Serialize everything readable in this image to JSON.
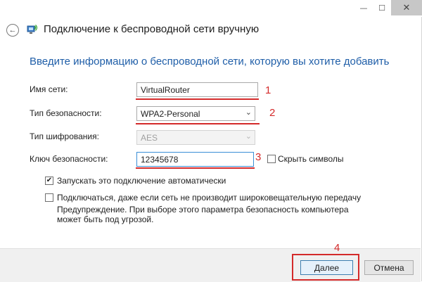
{
  "window": {
    "controls": {
      "minimize": "—",
      "maximize": "☐",
      "close": "✕"
    }
  },
  "header": {
    "back": "←",
    "title": "Подключение к беспроводной сети вручную"
  },
  "main": {
    "heading": "Введите информацию о беспроводной сети, которую вы хотите добавить"
  },
  "form": {
    "network_name": {
      "label": "Имя сети:",
      "value": "VirtualRouter"
    },
    "security_type": {
      "label": "Тип безопасности:",
      "value": "WPA2-Personal"
    },
    "encryption_type": {
      "label": "Тип шифрования:",
      "value": "AES"
    },
    "security_key": {
      "label": "Ключ безопасности:",
      "value": "12345678"
    },
    "hide_characters": {
      "label": "Скрыть символы",
      "checked": false
    }
  },
  "options": {
    "auto_connect": {
      "label": "Запускать это подключение автоматически",
      "checked": true
    },
    "connect_hidden": {
      "label": "Подключаться, даже если сеть не производит широковещательную передачу",
      "checked": false
    },
    "warning": "Предупреждение. При выборе этого параметра безопасность компьютера может быть под угрозой."
  },
  "annotations": {
    "m1": "1",
    "m2": "2",
    "m3": "3",
    "m4": "4"
  },
  "buttons": {
    "next": "Далее",
    "cancel": "Отмена"
  },
  "colors": {
    "accent": "#1f5ea8",
    "annotation_red": "#d42a2a"
  },
  "icons": {
    "back": "back-arrow-icon",
    "network": "wireless-network-icon",
    "dropdown": "chevron-down-icon",
    "check": "check-icon"
  }
}
